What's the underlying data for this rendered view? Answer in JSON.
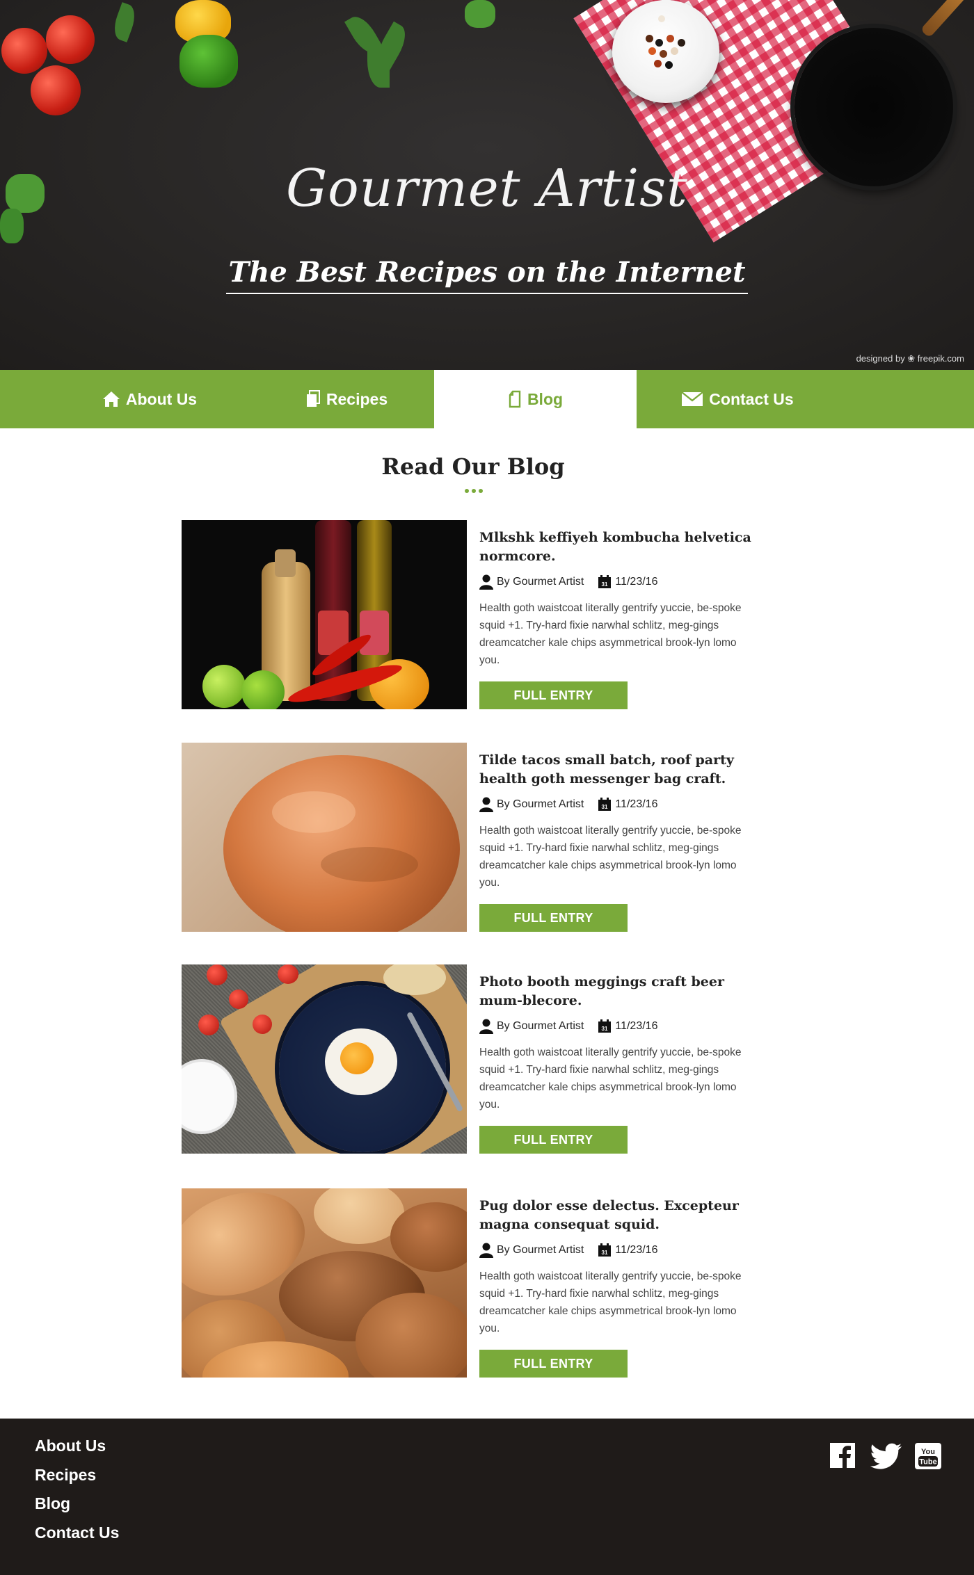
{
  "hero": {
    "title": "Gourmet Artist",
    "subtitle": "The Best Recipes on the Internet",
    "credit": "designed by ❀ freepik.com"
  },
  "nav": {
    "items": [
      {
        "label": "About Us",
        "icon": "home-icon",
        "active": false
      },
      {
        "label": "Recipes",
        "icon": "documents-icon",
        "active": false
      },
      {
        "label": "Blog",
        "icon": "document-icon",
        "active": true
      },
      {
        "label": "Contact Us",
        "icon": "envelope-icon",
        "active": false
      }
    ]
  },
  "main": {
    "title": "Read Our Blog",
    "posts": [
      {
        "title": "Mlkshk keffiyeh kombucha helvetica normcore.",
        "author": "By Gourmet Artist",
        "date": "11/23/16",
        "excerpt": "Health goth waistcoat literally gentrify yuccie, be-spoke squid +1. Try-hard fixie narwhal schlitz, meg-gings dreamcatcher kale chips asymmetrical brook-lyn lomo you.",
        "button": "FULL ENTRY"
      },
      {
        "title": "Tilde tacos small batch, roof party health goth messenger bag craft.",
        "author": "By Gourmet Artist",
        "date": "11/23/16",
        "excerpt": "Health goth waistcoat literally gentrify yuccie, be-spoke squid +1. Try-hard fixie narwhal schlitz, meg-gings dreamcatcher kale chips asymmetrical brook-lyn lomo you.",
        "button": "FULL ENTRY"
      },
      {
        "title": "Photo booth meggings craft beer mum-blecore.",
        "author": "By Gourmet Artist",
        "date": "11/23/16",
        "excerpt": "Health goth waistcoat literally gentrify yuccie, be-spoke squid +1. Try-hard fixie narwhal schlitz, meg-gings dreamcatcher kale chips asymmetrical brook-lyn lomo you.",
        "button": "FULL ENTRY"
      },
      {
        "title": "Pug dolor esse delectus. Excepteur magna consequat squid.",
        "author": "By Gourmet Artist",
        "date": "11/23/16",
        "excerpt": "Health goth waistcoat literally gentrify yuccie, be-spoke squid +1. Try-hard fixie narwhal schlitz, meg-gings dreamcatcher kale chips asymmetrical brook-lyn lomo you.",
        "button": "FULL ENTRY"
      }
    ]
  },
  "footer": {
    "links": [
      "About Us",
      "Recipes",
      "Blog",
      "Contact Us"
    ],
    "social": [
      "facebook-icon",
      "twitter-icon",
      "youtube-icon"
    ],
    "youtube_text_1": "You",
    "youtube_text_2": "Tube"
  },
  "colors": {
    "accent": "#7aaa3a",
    "hero_bg": "#2a2827",
    "footer_bg": "#1f1b19"
  }
}
